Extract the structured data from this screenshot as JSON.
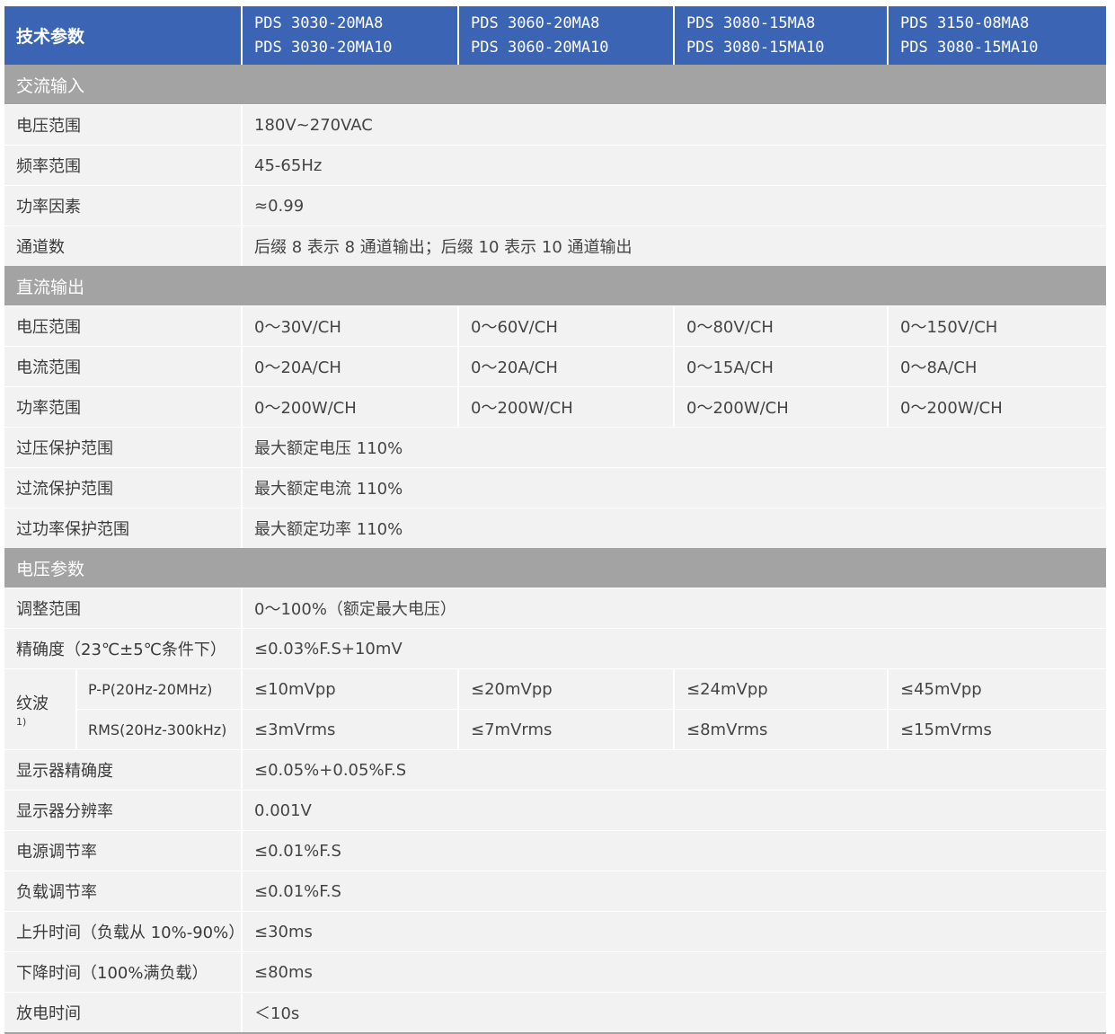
{
  "header": {
    "title": "技术参数",
    "models": [
      {
        "line1": "PDS 3030-20MA8",
        "line2": "PDS 3030-20MA10"
      },
      {
        "line1": "PDS 3060-20MA8",
        "line2": "PDS 3060-20MA10"
      },
      {
        "line1": "PDS 3080-15MA8",
        "line2": "PDS 3080-15MA10"
      },
      {
        "line1": "PDS 3150-08MA8",
        "line2": "PDS 3080-15MA10"
      }
    ]
  },
  "ac_input": {
    "title": "交流输入",
    "rows": [
      {
        "label": "电压范围",
        "value": "180V~270VAC"
      },
      {
        "label": "频率范围",
        "value": "45-65Hz"
      },
      {
        "label": "功率因素",
        "value": "≈0.99"
      },
      {
        "label": "通道数",
        "value": "后缀 8 表示 8 通道输出；后缀 10 表示 10 通道输出"
      }
    ]
  },
  "dc_output": {
    "title": "直流输出",
    "multi": [
      {
        "label": "电压范围",
        "values": [
          "0～30V/CH",
          "0～60V/CH",
          "0～80V/CH",
          "0～150V/CH"
        ]
      },
      {
        "label": "电流范围",
        "values": [
          "0～20A/CH",
          "0～20A/CH",
          "0～15A/CH",
          "0～8A/CH"
        ]
      },
      {
        "label": "功率范围",
        "values": [
          "0～200W/CH",
          "0～200W/CH",
          "0～200W/CH",
          "0～200W/CH"
        ]
      }
    ],
    "rows": [
      {
        "label": "过压保护范围",
        "value": "最大额定电压 110%"
      },
      {
        "label": "过流保护范围",
        "value": "最大额定电流 110%"
      },
      {
        "label": "过功率保护范围",
        "value": "最大额定功率 110%"
      }
    ]
  },
  "voltage_params": {
    "title": "电压参数",
    "rows_top": [
      {
        "label": "调整范围",
        "value": "0～100%（额定最大电压）"
      },
      {
        "label": "精确度（23℃±5℃条件下）",
        "value": "≤0.03%F.S+10mV"
      }
    ],
    "ripple": {
      "label": "纹波",
      "note": "1)",
      "pp": {
        "label": "P-P(20Hz-20MHz)",
        "values": [
          "≤10mVpp",
          "≤20mVpp",
          "≤24mVpp",
          "≤45mVpp"
        ]
      },
      "rms": {
        "label": "RMS(20Hz-300kHz)",
        "values": [
          "≤3mVrms",
          "≤7mVrms",
          "≤8mVrms",
          "≤15mVrms"
        ]
      }
    },
    "rows_bottom": [
      {
        "label": "显示器精确度",
        "value": "≤0.05%+0.05%F.S"
      },
      {
        "label": "显示器分辨率",
        "value": "0.001V"
      },
      {
        "label": "电源调节率",
        "value": "≤0.01%F.S"
      },
      {
        "label": "负载调节率",
        "value": "≤0.01%F.S"
      },
      {
        "label": "上升时间（负载从 10%-90%）",
        "value": "≤30ms"
      },
      {
        "label": "下降时间（100%满负载）",
        "value": "≤80ms"
      },
      {
        "label": "放电时间",
        "value": "＜10s"
      }
    ]
  }
}
